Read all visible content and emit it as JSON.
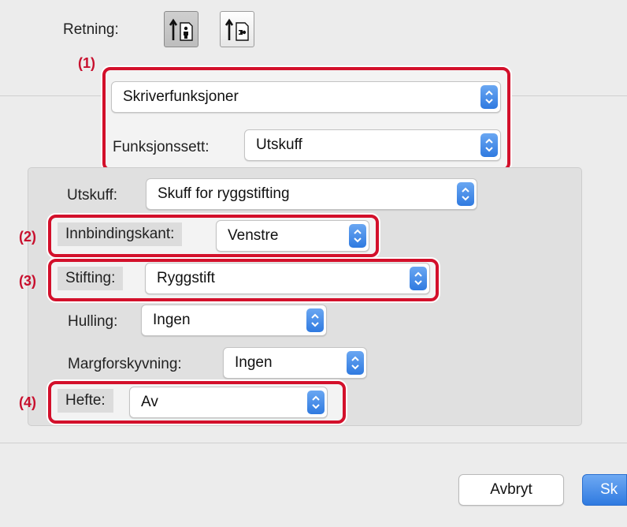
{
  "orientation": {
    "label": "Retning:",
    "options": [
      {
        "icon": "portrait-orientation-icon",
        "selected": true
      },
      {
        "icon": "landscape-orientation-icon",
        "selected": false
      }
    ]
  },
  "callouts": {
    "c1": "(1)",
    "c2": "(2)",
    "c3": "(3)",
    "c4": "(4)"
  },
  "panel_menu": {
    "value": "Skriverfunksjoner"
  },
  "feature_set": {
    "label": "Funksjonssett:",
    "value": "Utskuff"
  },
  "output_tray": {
    "label": "Utskuff:",
    "value": "Skuff for ryggstifting"
  },
  "binding_edge": {
    "label": "Innbindingskant:",
    "value": "Venstre"
  },
  "stapling": {
    "label": "Stifting:",
    "value": "Ryggstift"
  },
  "punch": {
    "label": "Hulling:",
    "value": "Ingen"
  },
  "margin_shift": {
    "label": "Margforskyvning:",
    "value": "Ingen"
  },
  "booklet": {
    "label": "Hefte:",
    "value": "Av"
  },
  "buttons": {
    "cancel": "Avbryt",
    "print": "Sk"
  },
  "colors": {
    "accent": "#2f7ae0",
    "callout": "#d3102b"
  }
}
